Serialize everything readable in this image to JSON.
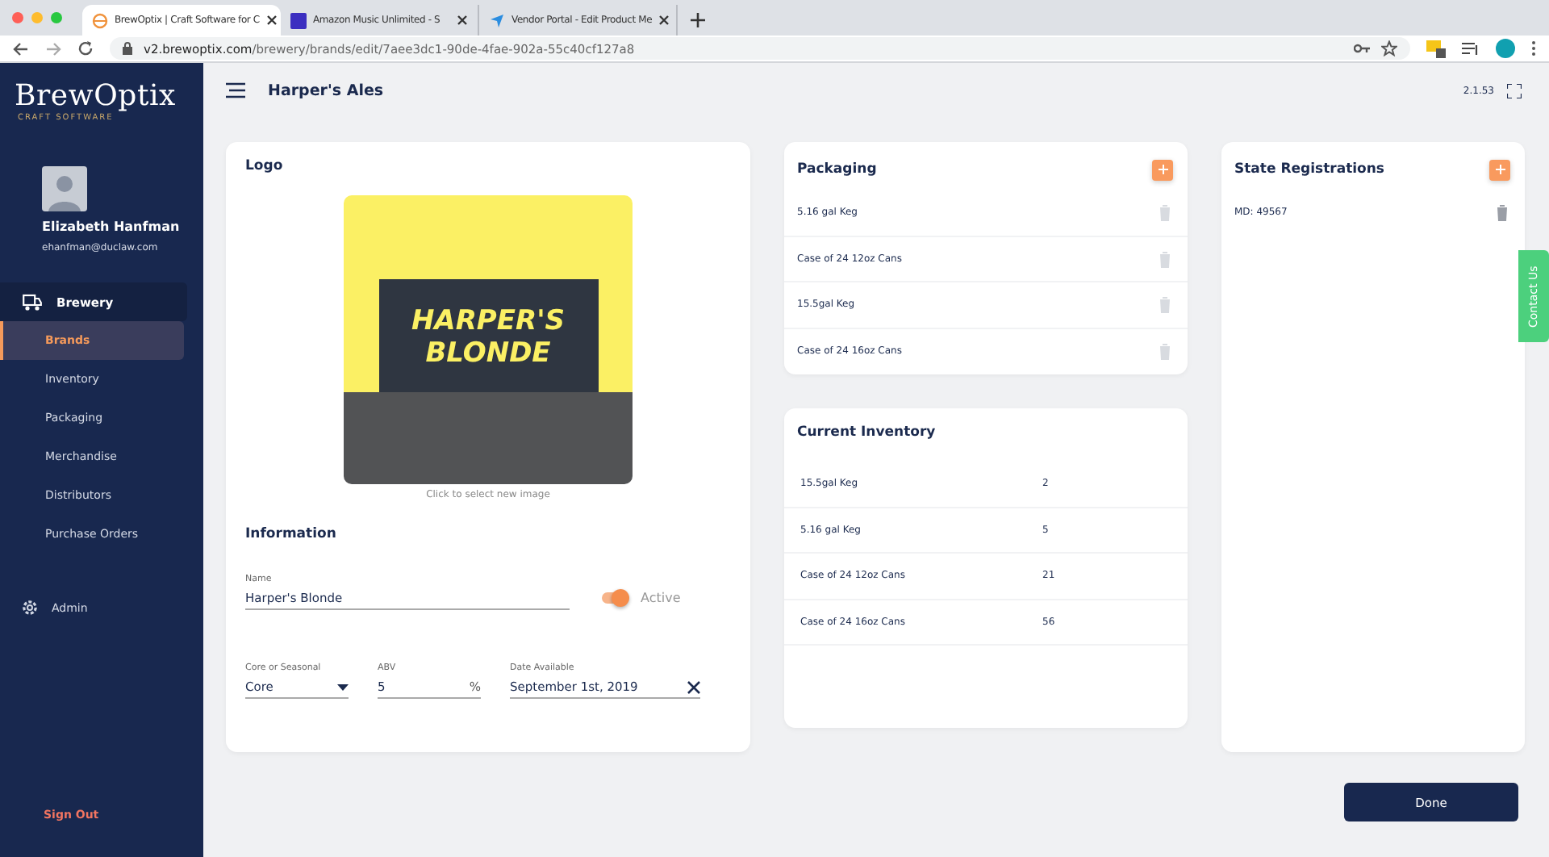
{
  "browser": {
    "tabs": [
      {
        "title": "BrewOptix | Craft Software for C",
        "selected": true
      },
      {
        "title": "Amazon Music Unlimited - S",
        "selected": false
      },
      {
        "title": "Vendor Portal - Edit Product Me",
        "selected": false
      }
    ],
    "url_host": "v2.brewoptix.com",
    "url_path": "/brewery/brands/edit/7aee3dc1-90de-4fae-902a-55c40cf127a8"
  },
  "sidebar": {
    "brand": "BrewOptix",
    "tagline": "CRAFT SOFTWARE",
    "user_name": "Elizabeth Hanfman",
    "user_email": "ehanfman@duclaw.com",
    "section": "Brewery",
    "items": [
      {
        "label": "Brands",
        "selected": true
      },
      {
        "label": "Inventory",
        "selected": false
      },
      {
        "label": "Packaging",
        "selected": false
      },
      {
        "label": "Merchandise",
        "selected": false
      },
      {
        "label": "Distributors",
        "selected": false
      },
      {
        "label": "Purchase Orders",
        "selected": false
      }
    ],
    "admin": "Admin",
    "sign_out": "Sign Out"
  },
  "header": {
    "title": "Harper's Ales",
    "version": "2.1.53"
  },
  "logo_card": {
    "title": "Logo",
    "image_lines": [
      "HARPER'S",
      "BLONDE"
    ],
    "hint": "Click to select new image"
  },
  "information": {
    "title": "Information",
    "name_label": "Name",
    "name_value": "Harper's Blonde",
    "active_label": "Active",
    "active": true,
    "type_label": "Core or Seasonal",
    "type_value": "Core",
    "abv_label": "ABV",
    "abv_value": "5",
    "abv_unit": "%",
    "date_label": "Date Available",
    "date_value": "September 1st, 2019"
  },
  "packaging": {
    "title": "Packaging",
    "items": [
      "5.16 gal Keg",
      "Case of 24 12oz Cans",
      "15.5gal Keg",
      "Case of 24 16oz Cans"
    ]
  },
  "inventory": {
    "title": "Current Inventory",
    "rows": [
      {
        "item": "15.5gal Keg",
        "count": "2"
      },
      {
        "item": "5.16 gal Keg",
        "count": "5"
      },
      {
        "item": "Case of 24 12oz Cans",
        "count": "21"
      },
      {
        "item": "Case of 24 16oz Cans",
        "count": "56"
      }
    ]
  },
  "registrations": {
    "title": "State Registrations",
    "items": [
      "MD: 49567"
    ]
  },
  "contact_tab": "Contact Us",
  "done_button": "Done"
}
